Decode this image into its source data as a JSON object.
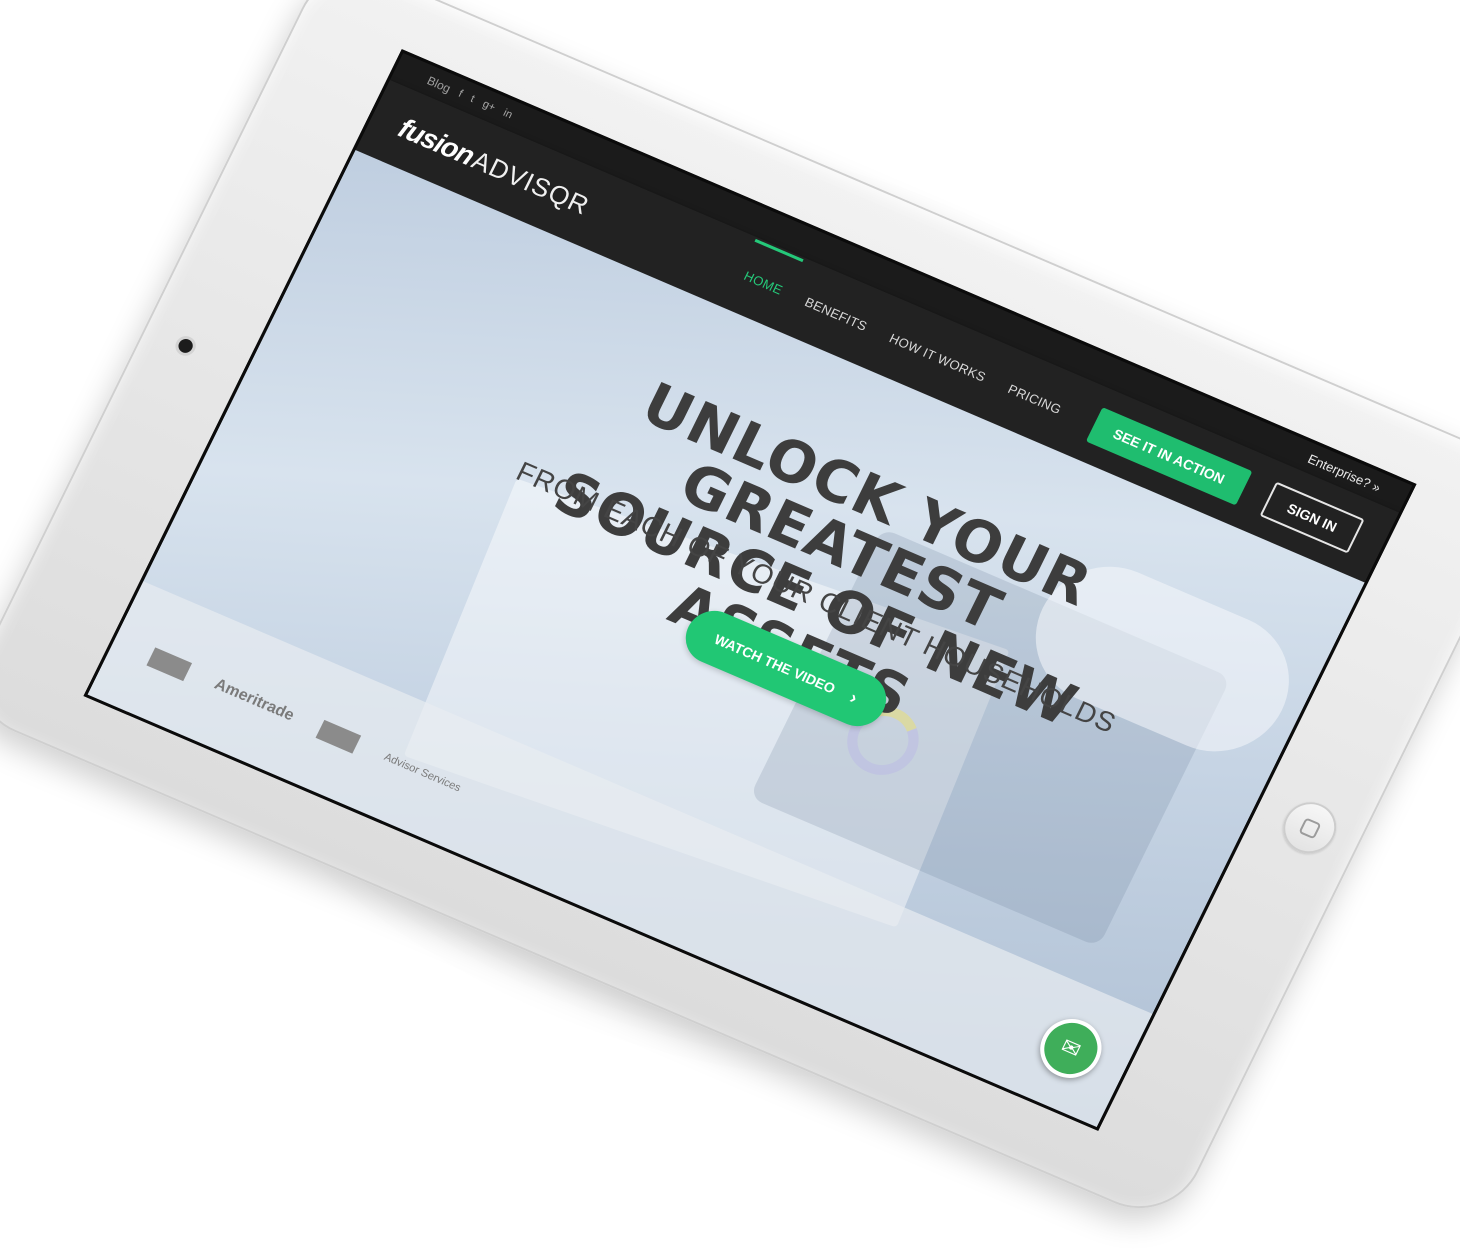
{
  "topbar": {
    "blog": "Blog",
    "social": [
      "f",
      "t",
      "g+",
      "in"
    ],
    "enterprise": "Enterprise? »"
  },
  "navbar": {
    "logo_fusion": "fusion",
    "logo_advisqr": "ADVISQR",
    "links": [
      "HOME",
      "BENEFITS",
      "HOW IT WORKS",
      "PRICING"
    ],
    "active_link": "HOME",
    "cta_label": "SEE IT IN ACTION",
    "signin_label": "SIGN IN"
  },
  "hero": {
    "title_line1": "UNLOCK YOUR GREATEST",
    "title_line2": "SOURCE OF NEW ASSETS",
    "subtitle": "FROM EACH OF YOUR CLIENT HOUSEHOLDS",
    "video_button": "WATCH THE VIDEO",
    "video_chevron": "›"
  },
  "partners": {
    "items": [
      "Ameritrade",
      "Advisor Services"
    ]
  },
  "colors": {
    "accent": "#21c774",
    "navbar": "#222222",
    "topbar": "#1b1b1b"
  },
  "icons": {
    "chat": "envelope-icon",
    "home_button": "home-square-icon",
    "camera": "camera-dot"
  }
}
